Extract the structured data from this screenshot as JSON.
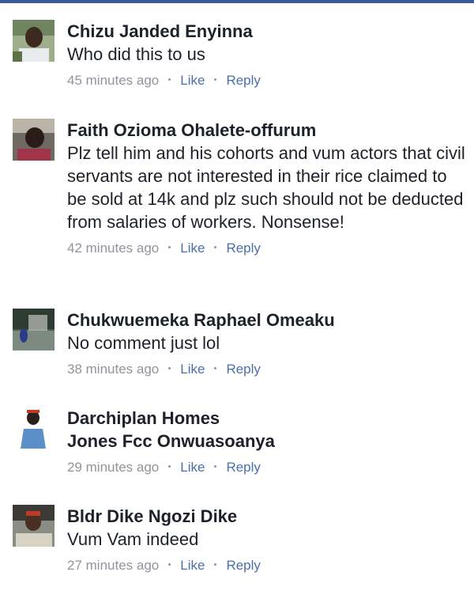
{
  "comments": [
    {
      "author": "Chizu Janded Enyinna",
      "text": "Who did this to us",
      "time": "45 minutes ago",
      "like": "Like",
      "reply": "Reply",
      "avatar_icon": "user-photo-icon"
    },
    {
      "author": "Faith Ozioma Ohalete-offurum",
      "text": "Plz tell him and his cohorts and vum actors that civil servants are not interested in their rice claimed to be sold at 14k and plz such should not be deducted from salaries of workers. Nonsense!",
      "time": "42 minutes ago",
      "like": "Like",
      "reply": "Reply",
      "avatar_icon": "user-photo-icon"
    },
    {
      "author": "Chukwuemeka Raphael Omeaku",
      "text": "No comment just lol",
      "time": "38 minutes ago",
      "like": "Like",
      "reply": "Reply",
      "avatar_icon": "user-photo-icon"
    },
    {
      "author": "Darchiplan Homes",
      "text": "Jones Fcc Onwuasoanya",
      "time": "29 minutes ago",
      "like": "Like",
      "reply": "Reply",
      "avatar_icon": "user-photo-icon"
    },
    {
      "author": "Bldr Dike Ngozi Dike",
      "text": "Vum Vam indeed",
      "time": "27 minutes ago",
      "like": "Like",
      "reply": "Reply",
      "avatar_icon": "user-photo-icon"
    }
  ],
  "colors": {
    "accent": "#3b5998",
    "link": "#4b6fa8",
    "meta": "#90949c",
    "text": "#1d2129"
  }
}
